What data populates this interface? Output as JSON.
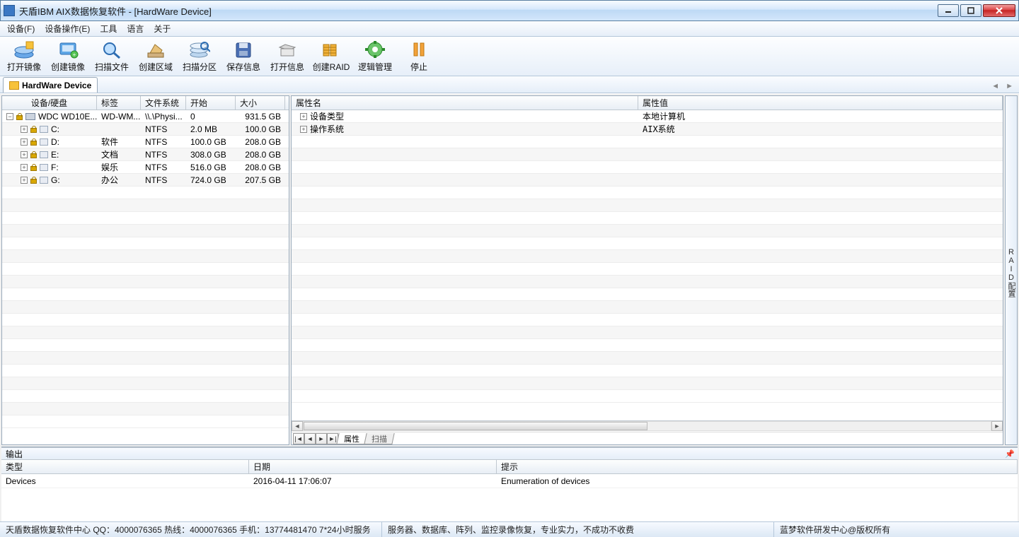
{
  "window": {
    "title": "天盾IBM AIX数据恢复软件 - [HardWare Device]"
  },
  "menu": {
    "device": "设备(F)",
    "device_ops": "设备操作(E)",
    "tools": "工具",
    "language": "语言",
    "about": "关于"
  },
  "toolbar": {
    "open_image": "打开镜像",
    "create_image": "创建镜像",
    "scan_files": "扫描文件",
    "create_region": "创建区域",
    "scan_partition": "扫描分区",
    "save_info": "保存信息",
    "open_info": "打开信息",
    "create_raid": "创建RAID",
    "logic_manage": "逻辑管理",
    "stop": "停止"
  },
  "doc_tab": {
    "label": "HardWare Device"
  },
  "side_tab": {
    "label": "RAID配置"
  },
  "left_grid": {
    "headers": {
      "device": "设备/硬盘",
      "label": "标签",
      "fs": "文件系统",
      "start": "开始",
      "size": "大小"
    },
    "rows": [
      {
        "device": "WDC WD10E...",
        "label": "WD-WM...",
        "fs": "\\\\.\\Physi...",
        "start": "0",
        "size": "931.5 GB",
        "type": "disk",
        "indent": 0
      },
      {
        "device": "C:",
        "label": "",
        "fs": "NTFS",
        "start": "2.0 MB",
        "size": "100.0 GB",
        "type": "drive",
        "indent": 1
      },
      {
        "device": "D:",
        "label": "软件",
        "fs": "NTFS",
        "start": "100.0 GB",
        "size": "208.0 GB",
        "type": "drive",
        "indent": 1
      },
      {
        "device": "E:",
        "label": "文档",
        "fs": "NTFS",
        "start": "308.0 GB",
        "size": "208.0 GB",
        "type": "drive",
        "indent": 1
      },
      {
        "device": "F:",
        "label": "娱乐",
        "fs": "NTFS",
        "start": "516.0 GB",
        "size": "208.0 GB",
        "type": "drive",
        "indent": 1
      },
      {
        "device": "G:",
        "label": "办公",
        "fs": "NTFS",
        "start": "724.0 GB",
        "size": "207.5 GB",
        "type": "drive",
        "indent": 1
      }
    ]
  },
  "right_grid": {
    "headers": {
      "name": "属性名",
      "value": "属性值"
    },
    "rows": [
      {
        "name": "设备类型",
        "value": "本地计算机"
      },
      {
        "name": "操作系统",
        "value": "AIX系统"
      }
    ],
    "tabs": {
      "attr": "属性",
      "scan": "扫描"
    }
  },
  "output": {
    "title": "输出",
    "headers": {
      "type": "类型",
      "date": "日期",
      "hint": "提示"
    },
    "rows": [
      {
        "type": "Devices",
        "date": "2016-04-11 17:06:07",
        "hint": "Enumeration of devices"
      }
    ]
  },
  "status": {
    "left": "天盾数据恢复软件中心 QQ：4000076365 热线：4000076365 手机：13774481470  7*24小时服务",
    "mid": "服务器、数据库、阵列、监控录像恢复，专业实力，不成功不收费",
    "right": "蓝梦软件研发中心@版权所有"
  }
}
